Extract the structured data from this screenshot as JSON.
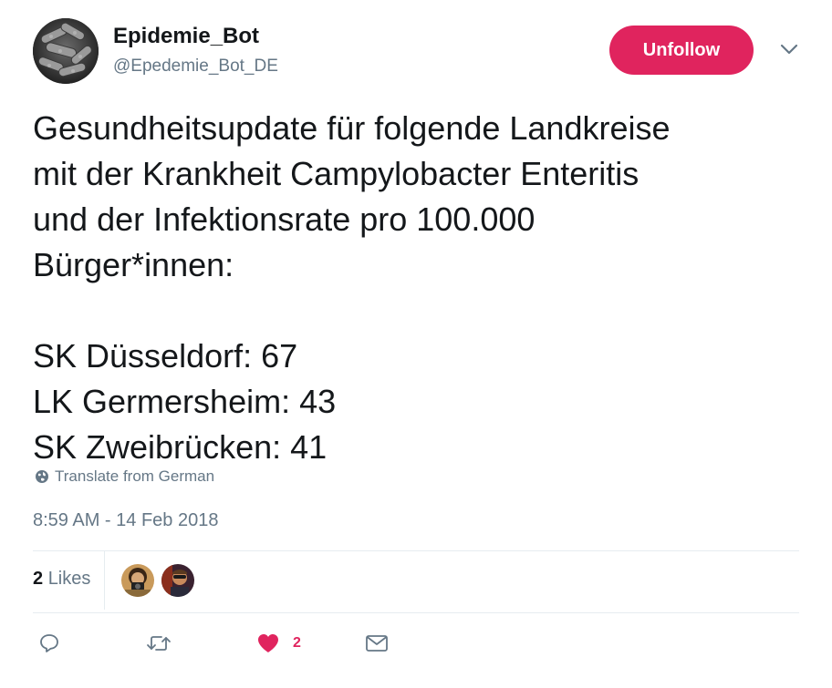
{
  "author": {
    "display_name": "Epidemie_Bot",
    "handle": "@Epedemie_Bot_DE",
    "avatar_icon": "bacteria-photo-avatar"
  },
  "actions_top": {
    "unfollow_label": "Unfollow",
    "menu_icon": "chevron-down-icon"
  },
  "tweet": {
    "lines": [
      "Gesundheitsupdate für folgende Landkreise",
      "mit der Krankheit Campylobacter Enteritis",
      "und der Infektionsrate pro 100.000",
      "Bürger*innen:"
    ],
    "entries": [
      "SK Düsseldorf: 67",
      "LK Germersheim: 43",
      "SK Zweibrücken: 41"
    ]
  },
  "translate_label": "Translate from German",
  "timestamp": "8:59 AM - 14 Feb 2018",
  "stats": {
    "likes_count": "2",
    "likes_label": "Likes"
  },
  "action_bar": {
    "reply_icon": "reply-icon",
    "retweet_icon": "retweet-icon",
    "like_icon": "heart-icon",
    "like_count": "2",
    "message_icon": "envelope-icon"
  },
  "colors": {
    "accent": "#e0245e",
    "secondary_text": "#657786",
    "divider": "#e6ecf0"
  }
}
